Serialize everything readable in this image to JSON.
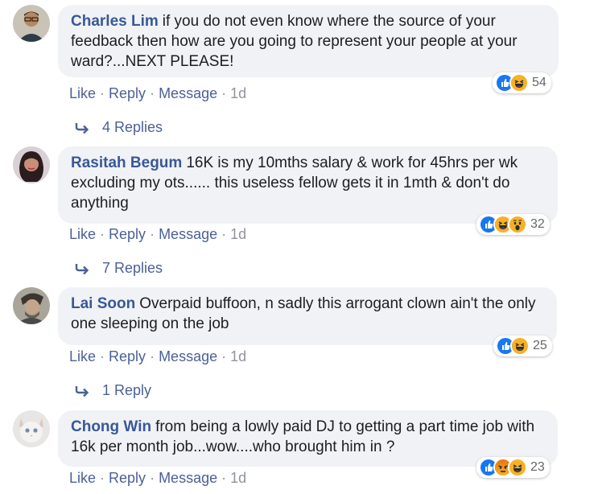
{
  "actions": {
    "like": "Like",
    "reply": "Reply",
    "message": "Message",
    "sep": "·"
  },
  "comments": [
    {
      "author": "Charles Lim",
      "text": "if you do not even know where the source of your feedback then how are you going to represent your people at your ward?...NEXT PLEASE!",
      "reactions": [
        "like",
        "haha"
      ],
      "reaction_count": "54",
      "time": "1d",
      "replies": "4 Replies"
    },
    {
      "author": "Rasitah Begum",
      "text": "16K is my 10mths salary & work for 45hrs per wk excluding my ots...... this useless fellow gets it in 1mth & don't do anything",
      "reactions": [
        "like",
        "haha",
        "wow"
      ],
      "reaction_count": "32",
      "time": "1d",
      "replies": "7 Replies"
    },
    {
      "author": "Lai Soon",
      "text": "Overpaid buffoon, n sadly this arrogant clown ain't the only one sleeping on the job",
      "reactions": [
        "like",
        "haha"
      ],
      "reaction_count": "25",
      "time": "1d",
      "replies": "1 Reply"
    },
    {
      "author": "Chong Win",
      "text": "from being a lowly paid DJ to getting a part time job with 16k per month job...wow....who brought him in ?",
      "reactions": [
        "like",
        "angry",
        "haha"
      ],
      "reaction_count": "23",
      "time": "1d"
    }
  ],
  "colors": {
    "link": "#385898",
    "like": "#1877f2",
    "haha": "#f7b125",
    "angry": "#e9710f"
  }
}
